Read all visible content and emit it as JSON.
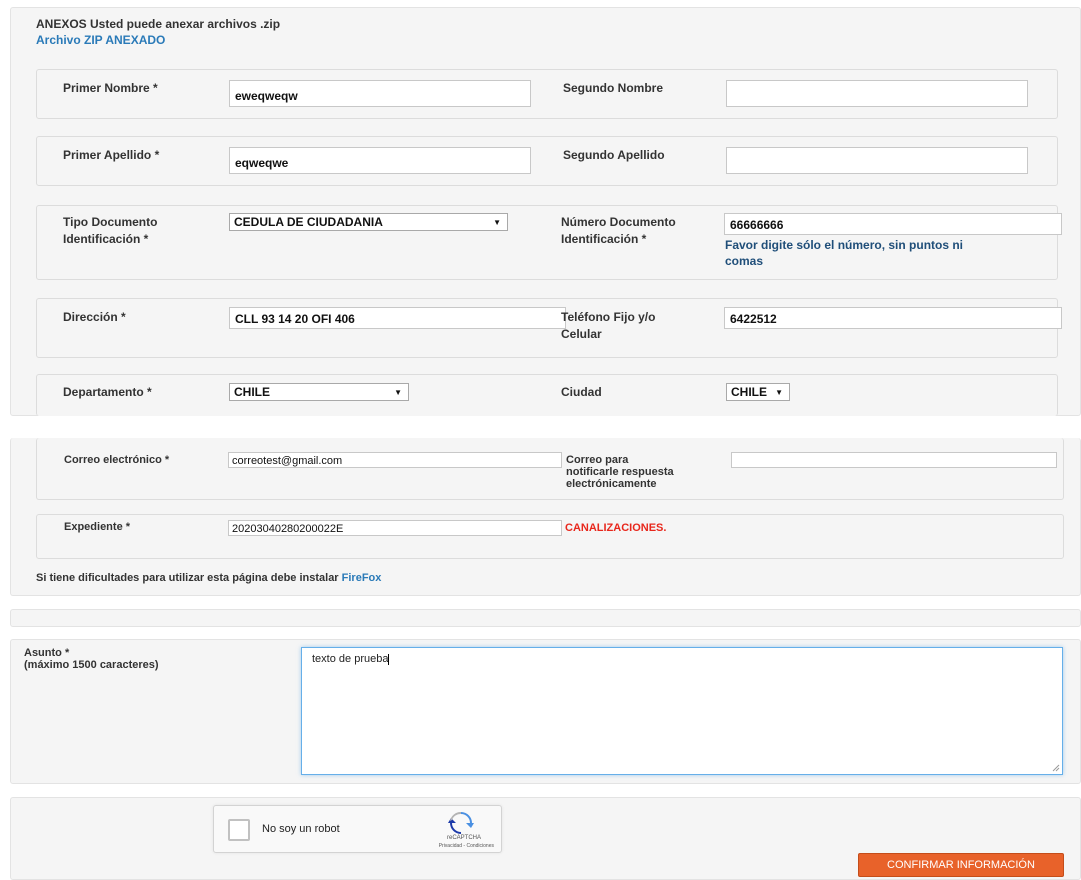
{
  "anexos": {
    "title": "ANEXOS Usted puede anexar archivos .zip",
    "link": "Archivo ZIP ANEXADO"
  },
  "form": {
    "primer_nombre": {
      "label": "Primer Nombre *",
      "value": "eweqweqw"
    },
    "segundo_nombre": {
      "label": "Segundo Nombre",
      "value": ""
    },
    "primer_apellido": {
      "label": "Primer Apellido *",
      "value": "eqweqwe"
    },
    "segundo_apellido": {
      "label": "Segundo Apellido",
      "value": ""
    },
    "tipo_documento": {
      "label_line1": "Tipo Documento",
      "label_line2": "Identificación *",
      "value": "CEDULA DE CIUDADANIA"
    },
    "numero_documento": {
      "label_line1": "Número Documento",
      "label_line2": "Identificación *",
      "value": "66666666",
      "hint_line1": "Favor digite sólo el número, sin puntos ni",
      "hint_line2": "comas"
    },
    "direccion": {
      "label": "Dirección *",
      "value": "CLL 93 14 20 OFI 406"
    },
    "telefono": {
      "label_line1": "Teléfono Fijo y/o",
      "label_line2": "Celular",
      "value": "6422512"
    },
    "departamento": {
      "label": "Departamento *",
      "value": "CHILE"
    },
    "ciudad": {
      "label": "Ciudad",
      "value": "CHILE"
    },
    "correo": {
      "label": "Correo electrónico *",
      "value": "correotest@gmail.com"
    },
    "correo_notificacion": {
      "label_line1": "Correo para",
      "label_line2": "notificarle respuesta",
      "label_line3": "electrónicamente",
      "value": ""
    },
    "expediente": {
      "label": "Expediente *",
      "value": "20203040280200022E",
      "tag": "CANALIZACIONES."
    }
  },
  "firefox_note": {
    "text": "Si tiene dificultades para utilizar esta página debe instalar ",
    "link": "FireFox"
  },
  "asunto": {
    "label_line1": "Asunto *",
    "label_line2": "(máximo 1500 caracteres)",
    "value": "texto de prueba"
  },
  "captcha": {
    "label": "No soy un robot",
    "brand": "reCAPTCHA",
    "links": "Privacidad - Condiciones"
  },
  "submit": {
    "label": "CONFIRMAR INFORMACIÓN"
  },
  "colors": {
    "accent_button": "#e8622a",
    "link": "#2a7ab8",
    "error_tag": "#e8271c",
    "hint": "#1f4e79"
  }
}
